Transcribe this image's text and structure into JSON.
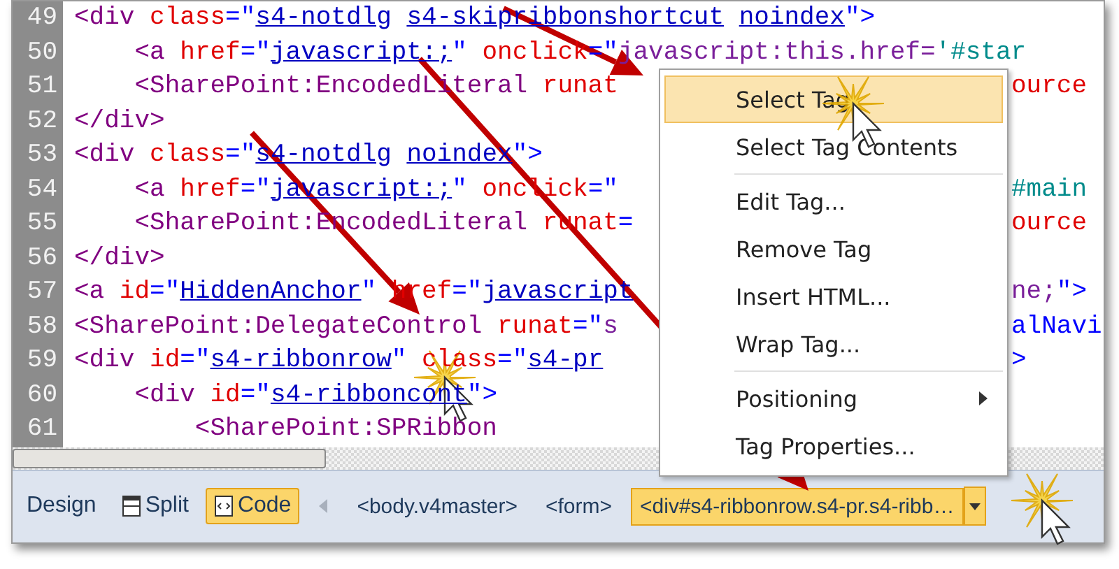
{
  "editor": {
    "lines": [
      {
        "number": "49",
        "code": [
          {
            "kind": "tag",
            "text": "<div "
          },
          {
            "kind": "attr",
            "text": "class"
          },
          {
            "kind": "punct",
            "text": "=\""
          },
          {
            "kind": "value",
            "text": "s4-notdlg s4-skipribbonshortcut noindex"
          },
          {
            "kind": "punct",
            "text": "\">"
          }
        ]
      },
      {
        "number": "50",
        "code": [
          {
            "kind": "tag",
            "text": "    <a "
          },
          {
            "kind": "attr",
            "text": "href"
          },
          {
            "kind": "punct",
            "text": "=\""
          },
          {
            "kind": "value",
            "text": "javascript:;"
          },
          {
            "kind": "punct",
            "text": "\" "
          },
          {
            "kind": "attr",
            "text": "onclick"
          },
          {
            "kind": "punct",
            "text": "=\""
          },
          {
            "kind": "script",
            "text": "javascript:this.href="
          },
          {
            "kind": "anchor",
            "text": "'#star"
          }
        ]
      },
      {
        "number": "51",
        "code": [
          {
            "kind": "tag",
            "text": "    <SharePoint:EncodedLiteral "
          },
          {
            "kind": "attr",
            "text": "runat"
          }
        ],
        "tail": [
          {
            "kind": "attr",
            "text": "ource"
          }
        ]
      },
      {
        "number": "52",
        "code": [
          {
            "kind": "tag",
            "text": "</div>"
          }
        ]
      },
      {
        "number": "53",
        "code": [
          {
            "kind": "tag",
            "text": "<div "
          },
          {
            "kind": "attr",
            "text": "class"
          },
          {
            "kind": "punct",
            "text": "=\""
          },
          {
            "kind": "value",
            "text": "s4-notdlg noindex"
          },
          {
            "kind": "punct",
            "text": "\">"
          }
        ]
      },
      {
        "number": "54",
        "code": [
          {
            "kind": "tag",
            "text": "    <a "
          },
          {
            "kind": "attr",
            "text": "href"
          },
          {
            "kind": "punct",
            "text": "=\""
          },
          {
            "kind": "value",
            "text": "javascript:;"
          },
          {
            "kind": "punct",
            "text": "\" "
          },
          {
            "kind": "attr",
            "text": "onclick"
          },
          {
            "kind": "punct",
            "text": "=\""
          }
        ],
        "tail": [
          {
            "kind": "anchor",
            "text": "#main"
          }
        ]
      },
      {
        "number": "55",
        "code": [
          {
            "kind": "tag",
            "text": "    <SharePoint:EncodedLiteral "
          },
          {
            "kind": "attr",
            "text": "runat"
          },
          {
            "kind": "punct",
            "text": "="
          }
        ],
        "tail": [
          {
            "kind": "attr",
            "text": "ource"
          }
        ]
      },
      {
        "number": "56",
        "code": [
          {
            "kind": "tag",
            "text": "</div>"
          }
        ]
      },
      {
        "number": "57",
        "code": [
          {
            "kind": "tag",
            "text": "<a "
          },
          {
            "kind": "attr",
            "text": "id"
          },
          {
            "kind": "punct",
            "text": "=\""
          },
          {
            "kind": "value",
            "text": "HiddenAnchor"
          },
          {
            "kind": "punct",
            "text": "\" "
          },
          {
            "kind": "attr",
            "text": "href"
          },
          {
            "kind": "punct",
            "text": "=\""
          },
          {
            "kind": "value",
            "text": "javascript"
          }
        ],
        "tail": [
          {
            "kind": "script",
            "text": "ne;"
          },
          {
            "kind": "punct",
            "text": "\">"
          }
        ]
      },
      {
        "number": "58",
        "code": [
          {
            "kind": "tag",
            "text": "<SharePoint:DelegateControl "
          },
          {
            "kind": "attr",
            "text": "runat"
          },
          {
            "kind": "punct",
            "text": "=\""
          },
          {
            "kind": "script",
            "text": "s"
          }
        ],
        "tail": [
          {
            "kind": "punct",
            "text": "alNavi"
          }
        ]
      },
      {
        "number": "59",
        "code": [
          {
            "kind": "tag",
            "text": "<div "
          },
          {
            "kind": "attr",
            "text": "id"
          },
          {
            "kind": "punct",
            "text": "=\""
          },
          {
            "kind": "value",
            "text": "s4-ribbonrow"
          },
          {
            "kind": "punct",
            "text": "\" "
          },
          {
            "kind": "attr",
            "text": "class"
          },
          {
            "kind": "punct",
            "text": "=\""
          },
          {
            "kind": "value",
            "text": "s4-pr"
          }
        ],
        "tail": [
          {
            "kind": "punct",
            "text": ">"
          }
        ]
      },
      {
        "number": "60",
        "code": [
          {
            "kind": "tag",
            "text": "    <div "
          },
          {
            "kind": "attr",
            "text": "id"
          },
          {
            "kind": "punct",
            "text": "=\""
          },
          {
            "kind": "value",
            "text": "s4-ribboncont"
          },
          {
            "kind": "punct",
            "text": "\">"
          }
        ]
      },
      {
        "number": "61",
        "code": [
          {
            "kind": "tag",
            "text": "        <SharePoint:SPRibbon"
          }
        ]
      }
    ]
  },
  "context_menu": {
    "items": [
      {
        "kind": "item",
        "label": "Select Tag",
        "selected": true
      },
      {
        "kind": "item",
        "label": "Select Tag Contents",
        "selected": false
      },
      {
        "kind": "separator"
      },
      {
        "kind": "item",
        "label": "Edit Tag...",
        "selected": false
      },
      {
        "kind": "item",
        "label": "Remove Tag",
        "selected": false
      },
      {
        "kind": "item",
        "label": "Insert HTML...",
        "selected": false
      },
      {
        "kind": "item",
        "label": "Wrap Tag...",
        "selected": false
      },
      {
        "kind": "separator"
      },
      {
        "kind": "submenu",
        "label": "Positioning",
        "selected": false
      },
      {
        "kind": "item",
        "label": "Tag Properties...",
        "selected": false
      }
    ]
  },
  "status_bar": {
    "view_tabs": [
      {
        "kind": "design",
        "label": "Design",
        "selected": false
      },
      {
        "kind": "split",
        "label": "Split",
        "selected": false
      },
      {
        "kind": "code",
        "label": "Code",
        "selected": true
      }
    ],
    "breadcrumbs": [
      {
        "label": "<body.v4master>",
        "selected": false
      },
      {
        "label": "<form>",
        "selected": false
      },
      {
        "label": "<div#s4-ribbonrow.s4-pr.s4-ribb…",
        "selected": true
      }
    ]
  }
}
